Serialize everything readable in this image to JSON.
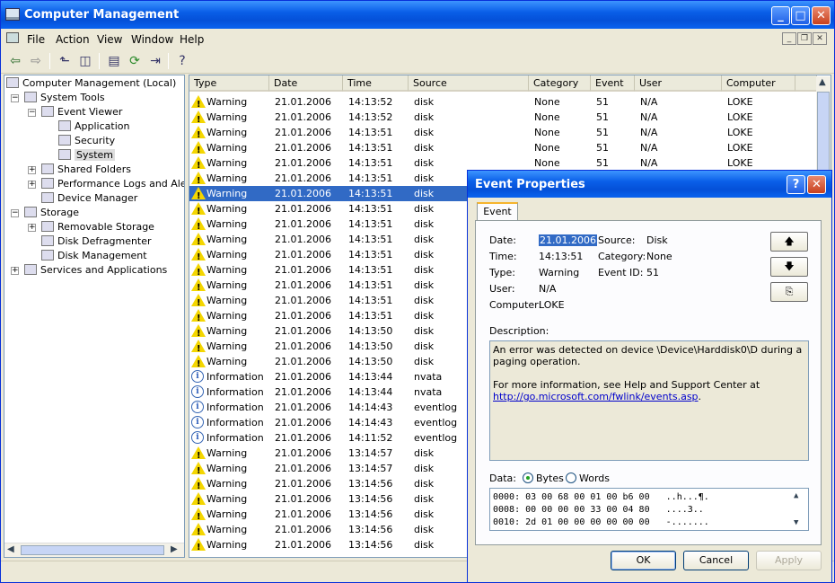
{
  "window": {
    "title": "Computer Management"
  },
  "menu": {
    "items": [
      "File",
      "Action",
      "View",
      "Window",
      "Help"
    ]
  },
  "tree": {
    "items": [
      {
        "label": "Computer Management (Local)",
        "indent": 0
      },
      {
        "label": "System Tools",
        "indent": 1
      },
      {
        "label": "Event Viewer",
        "indent": 2
      },
      {
        "label": "Application",
        "indent": 3
      },
      {
        "label": "Security",
        "indent": 3
      },
      {
        "label": "System",
        "indent": 3,
        "selected": true
      },
      {
        "label": "Shared Folders",
        "indent": 2
      },
      {
        "label": "Performance Logs and Alerts",
        "indent": 2
      },
      {
        "label": "Device Manager",
        "indent": 2
      },
      {
        "label": "Storage",
        "indent": 1
      },
      {
        "label": "Removable Storage",
        "indent": 2
      },
      {
        "label": "Disk Defragmenter",
        "indent": 2
      },
      {
        "label": "Disk Management",
        "indent": 2
      },
      {
        "label": "Services and Applications",
        "indent": 1
      }
    ]
  },
  "list": {
    "columns": [
      "Type",
      "Date",
      "Time",
      "Source",
      "Category",
      "Event",
      "User",
      "Computer"
    ],
    "rows": [
      {
        "type": "Warning",
        "date": "21.01.2006",
        "time": "14:13:52",
        "source": "disk",
        "category": "None",
        "event": "51",
        "user": "N/A",
        "computer": "LOKE"
      },
      {
        "type": "Warning",
        "date": "21.01.2006",
        "time": "14:13:52",
        "source": "disk",
        "category": "None",
        "event": "51",
        "user": "N/A",
        "computer": "LOKE"
      },
      {
        "type": "Warning",
        "date": "21.01.2006",
        "time": "14:13:51",
        "source": "disk",
        "category": "None",
        "event": "51",
        "user": "N/A",
        "computer": "LOKE"
      },
      {
        "type": "Warning",
        "date": "21.01.2006",
        "time": "14:13:51",
        "source": "disk",
        "category": "None",
        "event": "51",
        "user": "N/A",
        "computer": "LOKE"
      },
      {
        "type": "Warning",
        "date": "21.01.2006",
        "time": "14:13:51",
        "source": "disk",
        "category": "None",
        "event": "51",
        "user": "N/A",
        "computer": "LOKE"
      },
      {
        "type": "Warning",
        "date": "21.01.2006",
        "time": "14:13:51",
        "source": "disk",
        "category": "",
        "event": "",
        "user": "",
        "computer": ""
      },
      {
        "type": "Warning",
        "date": "21.01.2006",
        "time": "14:13:51",
        "source": "disk",
        "category": "",
        "event": "",
        "user": "",
        "computer": "",
        "selected": true
      },
      {
        "type": "Warning",
        "date": "21.01.2006",
        "time": "14:13:51",
        "source": "disk",
        "category": "",
        "event": "",
        "user": "",
        "computer": ""
      },
      {
        "type": "Warning",
        "date": "21.01.2006",
        "time": "14:13:51",
        "source": "disk",
        "category": "",
        "event": "",
        "user": "",
        "computer": ""
      },
      {
        "type": "Warning",
        "date": "21.01.2006",
        "time": "14:13:51",
        "source": "disk",
        "category": "",
        "event": "",
        "user": "",
        "computer": ""
      },
      {
        "type": "Warning",
        "date": "21.01.2006",
        "time": "14:13:51",
        "source": "disk",
        "category": "",
        "event": "",
        "user": "",
        "computer": ""
      },
      {
        "type": "Warning",
        "date": "21.01.2006",
        "time": "14:13:51",
        "source": "disk",
        "category": "",
        "event": "",
        "user": "",
        "computer": ""
      },
      {
        "type": "Warning",
        "date": "21.01.2006",
        "time": "14:13:51",
        "source": "disk",
        "category": "",
        "event": "",
        "user": "",
        "computer": ""
      },
      {
        "type": "Warning",
        "date": "21.01.2006",
        "time": "14:13:51",
        "source": "disk",
        "category": "",
        "event": "",
        "user": "",
        "computer": ""
      },
      {
        "type": "Warning",
        "date": "21.01.2006",
        "time": "14:13:51",
        "source": "disk",
        "category": "",
        "event": "",
        "user": "",
        "computer": ""
      },
      {
        "type": "Warning",
        "date": "21.01.2006",
        "time": "14:13:50",
        "source": "disk",
        "category": "",
        "event": "",
        "user": "",
        "computer": ""
      },
      {
        "type": "Warning",
        "date": "21.01.2006",
        "time": "14:13:50",
        "source": "disk",
        "category": "",
        "event": "",
        "user": "",
        "computer": ""
      },
      {
        "type": "Warning",
        "date": "21.01.2006",
        "time": "14:13:50",
        "source": "disk",
        "category": "",
        "event": "",
        "user": "",
        "computer": ""
      },
      {
        "type": "Information",
        "date": "21.01.2006",
        "time": "14:13:44",
        "source": "nvata",
        "category": "",
        "event": "",
        "user": "",
        "computer": ""
      },
      {
        "type": "Information",
        "date": "21.01.2006",
        "time": "14:13:44",
        "source": "nvata",
        "category": "",
        "event": "",
        "user": "",
        "computer": ""
      },
      {
        "type": "Information",
        "date": "21.01.2006",
        "time": "14:14:43",
        "source": "eventlog",
        "category": "",
        "event": "",
        "user": "",
        "computer": ""
      },
      {
        "type": "Information",
        "date": "21.01.2006",
        "time": "14:14:43",
        "source": "eventlog",
        "category": "",
        "event": "",
        "user": "",
        "computer": ""
      },
      {
        "type": "Information",
        "date": "21.01.2006",
        "time": "14:11:52",
        "source": "eventlog",
        "category": "",
        "event": "",
        "user": "",
        "computer": ""
      },
      {
        "type": "Warning",
        "date": "21.01.2006",
        "time": "13:14:57",
        "source": "disk",
        "category": "",
        "event": "",
        "user": "",
        "computer": ""
      },
      {
        "type": "Warning",
        "date": "21.01.2006",
        "time": "13:14:57",
        "source": "disk",
        "category": "",
        "event": "",
        "user": "",
        "computer": ""
      },
      {
        "type": "Warning",
        "date": "21.01.2006",
        "time": "13:14:56",
        "source": "disk",
        "category": "",
        "event": "",
        "user": "",
        "computer": ""
      },
      {
        "type": "Warning",
        "date": "21.01.2006",
        "time": "13:14:56",
        "source": "disk",
        "category": "",
        "event": "",
        "user": "",
        "computer": ""
      },
      {
        "type": "Warning",
        "date": "21.01.2006",
        "time": "13:14:56",
        "source": "disk",
        "category": "",
        "event": "",
        "user": "",
        "computer": ""
      },
      {
        "type": "Warning",
        "date": "21.01.2006",
        "time": "13:14:56",
        "source": "disk",
        "category": "",
        "event": "",
        "user": "",
        "computer": ""
      },
      {
        "type": "Warning",
        "date": "21.01.2006",
        "time": "13:14:56",
        "source": "disk",
        "category": "",
        "event": "",
        "user": "",
        "computer": ""
      }
    ]
  },
  "dialog": {
    "title": "Event Properties",
    "tab": "Event",
    "date_label": "Date:",
    "date": "21.01.2006",
    "source_label": "Source:",
    "source": "Disk",
    "time_label": "Time:",
    "time": "14:13:51",
    "category_label": "Category:",
    "category": "None",
    "type_label": "Type:",
    "type": "Warning",
    "eventid_label": "Event ID:",
    "eventid": "51",
    "user_label": "User:",
    "user": "N/A",
    "computer_label": "Computer:",
    "computer": "LOKE",
    "description_label": "Description:",
    "description_1": "An error was detected on device \\Device\\Harddisk0\\D during a paging operation.",
    "description_2": "For more information, see Help and Support Center at",
    "description_link": "http://go.microsoft.com/fwlink/events.asp",
    "description_end": ".",
    "data_label": "Data:",
    "bytes_label": "Bytes",
    "words_label": "Words",
    "data_lines": [
      "0000: 03 00 68 00 01 00 b6 00   ..h...¶.",
      "0008: 00 00 00 00 33 00 04 80   ....3..",
      "0010: 2d 01 00 00 00 00 00 00   -......."
    ],
    "ok_label": "OK",
    "cancel_label": "Cancel",
    "apply_label": "Apply"
  }
}
